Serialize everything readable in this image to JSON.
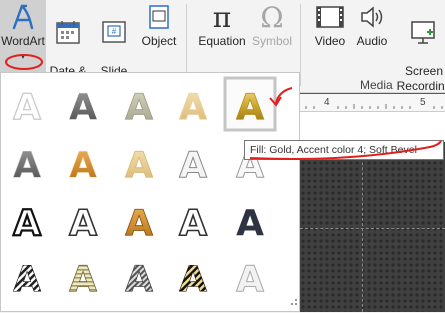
{
  "ribbon": {
    "buttons": [
      {
        "id": "wordart",
        "label": "WordArt",
        "icon": "wordart-icon",
        "state": "selected"
      },
      {
        "id": "datetime",
        "label": "Date &\nTime",
        "icon": "calendar-icon"
      },
      {
        "id": "slidenumber",
        "label": "Slide\nNumber",
        "icon": "slide-number-icon"
      },
      {
        "id": "object",
        "label": "Object",
        "icon": "object-icon"
      },
      {
        "id": "equation",
        "label": "Equation",
        "icon": "pi-icon"
      },
      {
        "id": "symbol",
        "label": "Symbol",
        "icon": "omega-icon",
        "state": "disabled"
      },
      {
        "id": "video",
        "label": "Video",
        "icon": "film-icon"
      },
      {
        "id": "audio",
        "label": "Audio",
        "icon": "speaker-icon"
      },
      {
        "id": "screenrec",
        "label": "Screen\nRecording",
        "icon": "screen-recording-icon"
      }
    ],
    "groups": {
      "media": "Media"
    }
  },
  "ruler": {
    "left_num": "4",
    "right_num": "5"
  },
  "tooltip": {
    "text": "Fill: Gold, Accent color 4; Soft Bevel"
  },
  "gallery": {
    "glyph": "A",
    "rows": 4,
    "cols": 5,
    "selected": "r0c4"
  },
  "colors": {
    "annotation": "#e0201c",
    "gold": "#c9a227"
  }
}
